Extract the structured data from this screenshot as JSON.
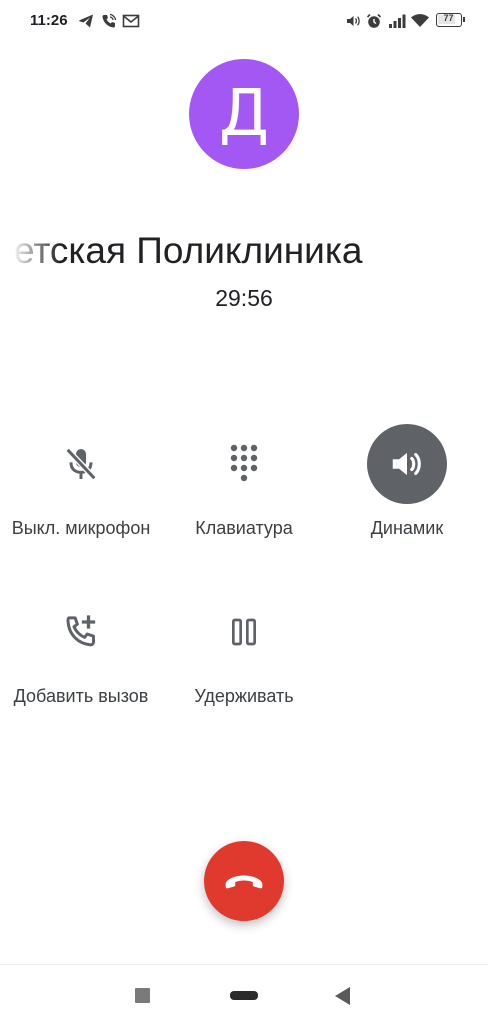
{
  "status_bar": {
    "time": "11:26",
    "left_icons": [
      "telegram-icon",
      "phone-wifi-call-icon",
      "mail-icon"
    ],
    "right_icons": [
      "volume-icon",
      "alarm-icon",
      "signal-icon",
      "wifi-icon"
    ],
    "battery": "77"
  },
  "avatar": {
    "letter": "Д",
    "color": "#a358f4"
  },
  "contact": {
    "name": "етская Поликлиника"
  },
  "call": {
    "timer": "29:56"
  },
  "actions": {
    "mute": {
      "label": "Выкл. микрофон",
      "icon": "mic-off-icon"
    },
    "keypad": {
      "label": "Клавиатура",
      "icon": "dialpad-icon"
    },
    "speaker": {
      "label": "Динамик",
      "icon": "speaker-icon",
      "active": true
    },
    "add_call": {
      "label": "Добавить вызов",
      "icon": "add-call-icon"
    },
    "hold": {
      "label": "Удерживать",
      "icon": "pause-icon"
    }
  },
  "end_call": {
    "icon": "hang-up-icon",
    "color": "#e03a2f"
  },
  "navigation": {
    "buttons": [
      "recents-button",
      "home-button",
      "back-button"
    ]
  }
}
